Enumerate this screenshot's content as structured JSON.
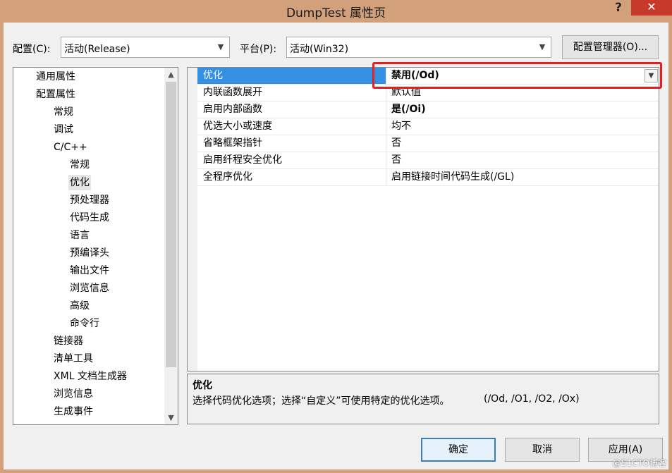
{
  "window": {
    "title": "DumpTest 属性页",
    "help_label": "?",
    "close_label": "✕"
  },
  "toolbar": {
    "config_label": "配置(C):",
    "config_value": "活动(Release)",
    "platform_label": "平台(P):",
    "platform_value": "活动(Win32)",
    "config_manager_label": "配置管理器(O)..."
  },
  "tree": {
    "items": [
      {
        "label": "通用属性",
        "level": 0
      },
      {
        "label": "配置属性",
        "level": 0
      },
      {
        "label": "常规",
        "level": 1
      },
      {
        "label": "调试",
        "level": 1
      },
      {
        "label": "C/C++",
        "level": 1
      },
      {
        "label": "常规",
        "level": 2
      },
      {
        "label": "优化",
        "level": 2,
        "selected": true
      },
      {
        "label": "预处理器",
        "level": 2
      },
      {
        "label": "代码生成",
        "level": 2
      },
      {
        "label": "语言",
        "level": 2
      },
      {
        "label": "预编译头",
        "level": 2
      },
      {
        "label": "输出文件",
        "level": 2
      },
      {
        "label": "浏览信息",
        "level": 2
      },
      {
        "label": "高级",
        "level": 2
      },
      {
        "label": "命令行",
        "level": 2
      },
      {
        "label": "链接器",
        "level": 1
      },
      {
        "label": "清单工具",
        "level": 1
      },
      {
        "label": "XML 文档生成器",
        "level": 1
      },
      {
        "label": "浏览信息",
        "level": 1
      },
      {
        "label": "生成事件",
        "level": 1
      }
    ]
  },
  "properties": {
    "rows": [
      {
        "name": "优化",
        "value": "禁用(/Od)",
        "bold": true,
        "selected": true
      },
      {
        "name": "内联函数展开",
        "value": "默认值",
        "bold": false
      },
      {
        "name": "启用内部函数",
        "value": "是(/Oi)",
        "bold": true
      },
      {
        "name": "优选大小或速度",
        "value": "均不",
        "bold": false
      },
      {
        "name": "省略框架指针",
        "value": "否",
        "bold": false
      },
      {
        "name": "启用纤程安全优化",
        "value": "否",
        "bold": false
      },
      {
        "name": "全程序优化",
        "value": "启用链接时间代码生成(/GL)",
        "bold": false
      }
    ]
  },
  "description": {
    "title": "优化",
    "text": "选择代码优化选项；选择“自定义”可使用特定的优化选项。",
    "options": "(/Od, /O1, /O2, /Ox)"
  },
  "buttons": {
    "ok": "确定",
    "cancel": "取消",
    "apply": "应用(A)"
  },
  "watermark": "@51CTO博客",
  "colors": {
    "selection": "#3390e3",
    "highlight_box": "#e2201f",
    "close_button": "#c7392a"
  }
}
